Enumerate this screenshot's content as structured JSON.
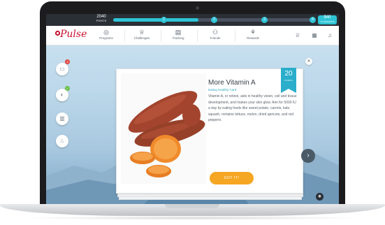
{
  "header": {
    "points_value": "2040",
    "points_label": "POINTS",
    "progress_fraction": 0.42,
    "milestones": [
      "1",
      "2",
      "3",
      "4"
    ],
    "reward_value": "$40",
    "reward_label": "TO REWARDS"
  },
  "nav": {
    "logo_text": "Pulse",
    "items": [
      {
        "label": "Programs",
        "icon": "globe-icon"
      },
      {
        "label": "Challenges",
        "icon": "trophy-icon"
      },
      {
        "label": "Tracking",
        "icon": "calendar-icon"
      },
      {
        "label": "Friends",
        "icon": "friends-icon"
      },
      {
        "label": "Rewards",
        "icon": "rewards-icon"
      }
    ]
  },
  "sidebar": {
    "cards_label": "CARDS",
    "cards_badge": "4",
    "check_badge": "✓"
  },
  "card": {
    "title": "More Vitamin A",
    "subtitle": "Eating Healthy Card",
    "body": "Vitamin A, or retinol, aids in healthy vision, cell and tissue development, and makes your skin glow. Aim for 5000 IU a day by eating foods like sweet potato, carrots, kale, squash, romaine lettuce, melon, dried apricots, and red peppers.",
    "points_value": "20",
    "points_label": "POINTS",
    "button_label": "GOT IT!"
  },
  "colors": {
    "accent": "#2ec4d6",
    "brand": "#c8102e",
    "button": "#f5a623"
  }
}
